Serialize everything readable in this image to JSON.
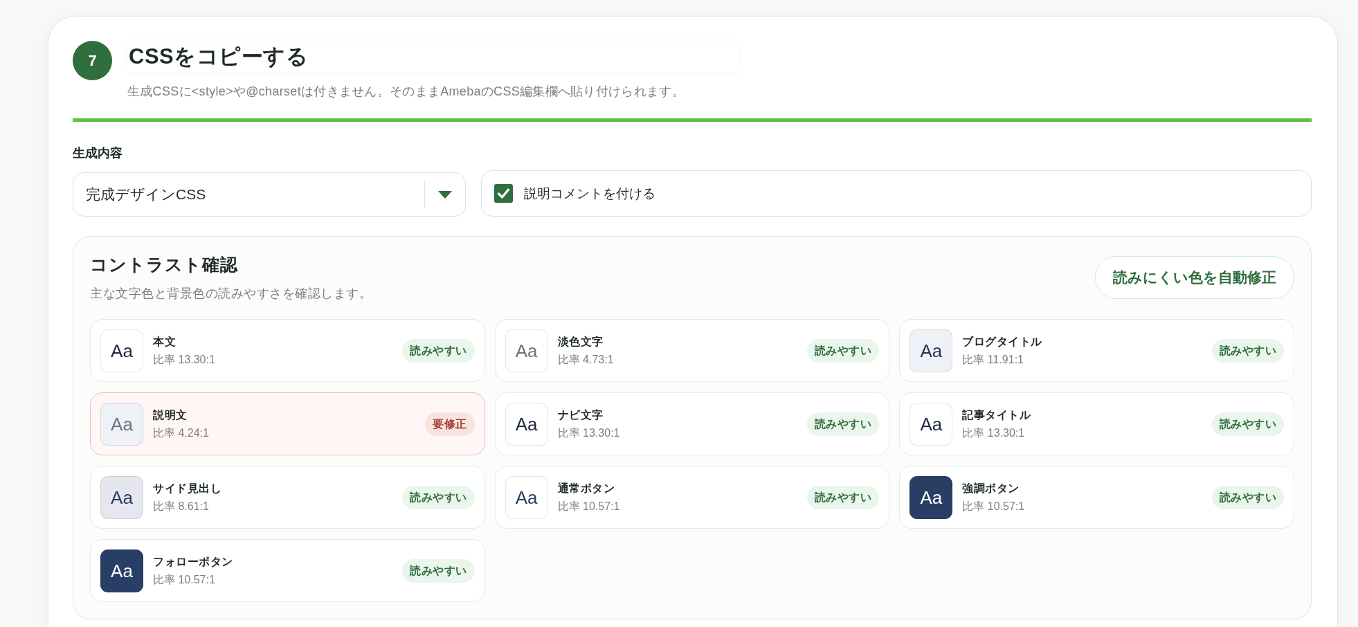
{
  "step": {
    "number": "7",
    "title": "CSSをコピーする",
    "description": "生成CSSに<style>や@charsetは付きません。そのままAmebaのCSS編集欄へ貼り付けられます。"
  },
  "output": {
    "label": "生成内容",
    "select": {
      "value": "完成デザインCSS"
    },
    "option": {
      "label": "説明コメントを付ける",
      "checked": true
    }
  },
  "contrast": {
    "title": "コントラスト確認",
    "description": "主な文字色と背景色の読みやすさを確認します。",
    "fix_button": "読みにくい色を自動修正",
    "items": [
      {
        "name": "本文",
        "ratio": "比率 13.30:1",
        "sample": {
          "text": "Aa",
          "color": "#1f2a44"
        },
        "color": "#ffffff",
        "needs_fix": false,
        "badge": "読みやすい"
      },
      {
        "name": "淡色文字",
        "ratio": "比率 4.73:1",
        "sample": {
          "text": "Aa",
          "color": "#6b7280"
        },
        "color": "#ffffff",
        "needs_fix": false,
        "badge": "読みやすい"
      },
      {
        "name": "ブログタイトル",
        "ratio": "比率 11.91:1",
        "sample": {
          "text": "Aa",
          "color": "#253553"
        },
        "color": "#eef1f6",
        "needs_fix": false,
        "badge": "読みやすい"
      },
      {
        "name": "説明文",
        "ratio": "比率 4.24:1",
        "sample": {
          "text": "Aa",
          "color": "#6b7280"
        },
        "color": "#eef1f6",
        "needs_fix": true,
        "badge": "要修正"
      },
      {
        "name": "ナビ文字",
        "ratio": "比率 13.30:1",
        "sample": {
          "text": "Aa",
          "color": "#1f2a44"
        },
        "color": "#ffffff",
        "needs_fix": false,
        "badge": "読みやすい"
      },
      {
        "name": "記事タイトル",
        "ratio": "比率 13.30:1",
        "sample": {
          "text": "Aa",
          "color": "#1f2a44"
        },
        "color": "#ffffff",
        "needs_fix": false,
        "badge": "読みやすい"
      },
      {
        "name": "サイド見出し",
        "ratio": "比率 8.61:1",
        "sample": {
          "text": "Aa",
          "color": "#283e65"
        },
        "color": "#e6e7ee",
        "needs_fix": false,
        "badge": "読みやすい"
      },
      {
        "name": "通常ボタン",
        "ratio": "比率 10.57:1",
        "sample": {
          "text": "Aa",
          "color": "#283e65"
        },
        "color": "#ffffff",
        "needs_fix": false,
        "badge": "読みやすい"
      },
      {
        "name": "強調ボタン",
        "ratio": "比率 10.57:1",
        "sample": {
          "text": "Aa",
          "color": "#ffffff"
        },
        "color": "#283e65",
        "needs_fix": false,
        "badge": "読みやすい"
      },
      {
        "name": "フォローボタン",
        "ratio": "比率 10.57:1",
        "sample": {
          "text": "Aa",
          "color": "#ffffff"
        },
        "color": "#283e65",
        "needs_fix": false,
        "badge": "読みやすい"
      }
    ]
  }
}
